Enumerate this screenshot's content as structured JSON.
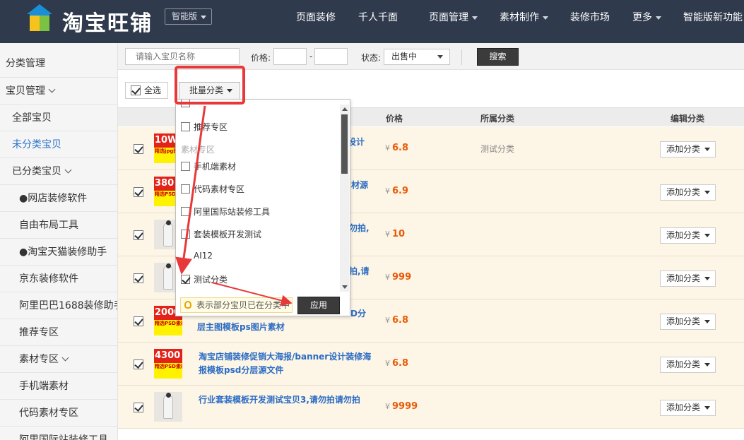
{
  "header": {
    "brand": "淘宝旺铺",
    "edition": "智能版",
    "nav": [
      "页面装修",
      "千人千面",
      "页面管理",
      "素材制作",
      "装修市场",
      "更多",
      "智能版新功能"
    ]
  },
  "sidebar": {
    "items": [
      {
        "label": "分类管理"
      },
      {
        "label": "宝贝管理"
      },
      {
        "label": "全部宝贝"
      },
      {
        "label": "未分类宝贝"
      },
      {
        "label": "已分类宝贝"
      },
      {
        "label": "●网店装修软件"
      },
      {
        "label": "自由布局工具"
      },
      {
        "label": "●淘宝天猫装修助手"
      },
      {
        "label": "京东装修软件"
      },
      {
        "label": "阿里巴巴1688装修助手"
      },
      {
        "label": "推荐专区"
      },
      {
        "label": "素材专区"
      },
      {
        "label": "手机端素材"
      },
      {
        "label": "代码素材专区"
      },
      {
        "label": "阿里国际站装修工具"
      }
    ]
  },
  "filter": {
    "search_placeholder": "请输入宝贝名称",
    "price_label": "价格:",
    "dash": "-",
    "status_label": "状态:",
    "status_value": "出售中",
    "search_button": "搜索"
  },
  "toolbar": {
    "select_all": "全选",
    "batch_category": "批量分类"
  },
  "table": {
    "headers": {
      "price": "价格",
      "category": "所属分类",
      "edit": "编辑分类"
    },
    "rows": [
      {
        "thumb_top": "10W",
        "thumb_bottom": "精选jpg图",
        "title": "设计",
        "yen": "¥",
        "price": "6.8",
        "category": "测试分类",
        "button": "添加分类"
      },
      {
        "thumb_top": "380",
        "thumb_bottom": "精选PSD素",
        "title": "材源",
        "yen": "¥",
        "price": "6.9",
        "category": "",
        "button": "添加分类"
      },
      {
        "thumb_top": "",
        "thumb_bottom": "",
        "title": "勿拍,",
        "yen": "¥",
        "price": "10",
        "category": "",
        "button": "添加分类"
      },
      {
        "thumb_top": "",
        "thumb_bottom": "",
        "title": "拍,请",
        "yen": "¥",
        "price": "999",
        "category": "",
        "button": "添加分类"
      },
      {
        "thumb_top": "2000",
        "thumb_bottom": "精选PSD素材",
        "title": "D分\n层主图模板ps图片素材",
        "yen": "¥",
        "price": "6.8",
        "category": "",
        "button": "添加分类"
      },
      {
        "thumb_top": "4300",
        "thumb_bottom": "精选PSD素材",
        "title": "淘宝店铺装修促销大海报/banner设计装修海报模板psd分层源文件",
        "yen": "¥",
        "price": "6.8",
        "category": "",
        "button": "添加分类"
      },
      {
        "thumb_top": "",
        "thumb_bottom": "",
        "title": "行业套装模板开发测试宝贝3,请勿拍请勿拍",
        "yen": "¥",
        "price": "9999",
        "category": "",
        "button": "添加分类"
      }
    ]
  },
  "popup": {
    "items": [
      {
        "label": "推荐专区",
        "checked": false,
        "group": false
      },
      {
        "label": "素材专区",
        "checked": false,
        "group": true
      },
      {
        "label": "手机端素材",
        "checked": false,
        "group": false
      },
      {
        "label": "代码素材专区",
        "checked": false,
        "group": false
      },
      {
        "label": "阿里国际站装修工具",
        "checked": false,
        "group": false
      },
      {
        "label": "套装模板开发测试",
        "checked": false,
        "group": false
      },
      {
        "label": "AI12",
        "checked": false,
        "group": false
      },
      {
        "label": "测试分类",
        "checked": true,
        "group": false
      }
    ],
    "tip": "表示部分宝贝已在分类中",
    "apply": "应用"
  },
  "colors": {
    "header_bg": "#2f3a4c",
    "link_blue": "#2b6cc4",
    "price_orange": "#e85b08",
    "row_bg": "#fdf5e6",
    "annotation_red": "#e8393a"
  }
}
